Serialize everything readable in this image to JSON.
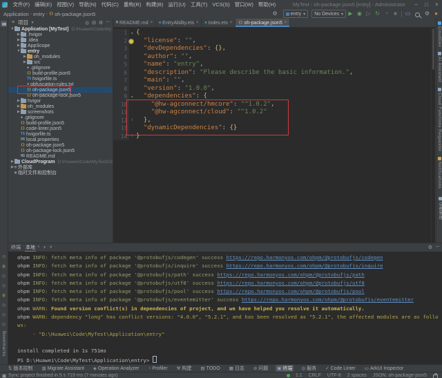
{
  "colors": {
    "accent_green": "#499c54",
    "annotation_red": "#cf3b3b",
    "link_blue": "#5f91c8",
    "warn_yellow": "#b3a24a",
    "selection_blue": "#234a6e",
    "notification_orange": "#cf8446"
  },
  "titlebar": {
    "title": "MyTest - oh-package.json5 [entry] - Administrator",
    "menus": [
      "文件(F)",
      "编辑(E)",
      "视图(V)",
      "导航(N)",
      "代码(C)",
      "重构(R)",
      "构建(B)",
      "运行(U)",
      "工具(T)",
      "VCS(S)",
      "窗口(W)",
      "帮助(H)"
    ],
    "window_buttons": [
      "minimize",
      "maximize",
      "close"
    ]
  },
  "toolbar": {
    "breadcrumbs": [
      "Application",
      "entry",
      "oh-package.json5"
    ],
    "module_selector": "entry",
    "device_selector": "No Devices",
    "icons": [
      "settings-sync-icon",
      "run-icon",
      "debug-icon",
      "attach-debugger-icon",
      "restart-app-icon",
      "profiler-icon",
      "stop-icon",
      "device-manager-icon",
      "search-everywhere-icon",
      "settings-icon",
      "notifications-icon"
    ]
  },
  "left_stripe": {
    "top_label": "项目",
    "bottom_label": "Bookmarks",
    "terminal_icon_count": 8
  },
  "project_panel": {
    "title": "项目",
    "header_icons": [
      "hamburger-icon",
      "locate-file-icon",
      "collapse-all-icon",
      "panel-settings-icon",
      "hide-panel-icon"
    ],
    "tree": [
      {
        "label": "Application [MyTest]",
        "path": "D:\\Huawei\\Code\\MyTest\\Application",
        "lvl": 0,
        "arrow": "open",
        "icon": "folder",
        "bold": true
      },
      {
        "label": ".hvigor",
        "lvl": 1,
        "arrow": "closed",
        "icon": "folder"
      },
      {
        "label": ".idea",
        "lvl": 1,
        "arrow": "closed",
        "icon": "folder"
      },
      {
        "label": "AppScope",
        "lvl": 1,
        "arrow": "closed",
        "icon": "folder"
      },
      {
        "label": "entry",
        "lvl": 1,
        "arrow": "open",
        "icon": "folder",
        "bold": true
      },
      {
        "label": "oh_modules",
        "lvl": 2,
        "arrow": "closed",
        "icon": "folder-orange"
      },
      {
        "label": "src",
        "lvl": 2,
        "arrow": "closed",
        "icon": "folder"
      },
      {
        "label": ".gitignore",
        "lvl": 2,
        "icon": "git"
      },
      {
        "label": "build-profile.json5",
        "lvl": 2,
        "icon": "json"
      },
      {
        "label": "hvigorfile.ts",
        "lvl": 2,
        "icon": "ts"
      },
      {
        "label": "obfuscation-rules.txt",
        "lvl": 2,
        "icon": "txt"
      },
      {
        "label": "oh-package.json5",
        "lvl": 2,
        "icon": "json",
        "selected": true,
        "annotated": true
      },
      {
        "label": "oh-package-lock.json5",
        "lvl": 2,
        "icon": "json"
      },
      {
        "label": "hvigor",
        "lvl": 1,
        "arrow": "closed",
        "icon": "folder"
      },
      {
        "label": "oh_modules",
        "lvl": 1,
        "arrow": "closed",
        "icon": "folder-orange"
      },
      {
        "label": "screenshots",
        "lvl": 1,
        "arrow": "closed",
        "icon": "folder"
      },
      {
        "label": ".gitignore",
        "lvl": 1,
        "icon": "git"
      },
      {
        "label": "build-profile.json5",
        "lvl": 1,
        "icon": "json"
      },
      {
        "label": "code-linter.json5",
        "lvl": 1,
        "icon": "json"
      },
      {
        "label": "hvigorfile.ts",
        "lvl": 1,
        "icon": "ts"
      },
      {
        "label": "local.properties",
        "lvl": 1,
        "icon": "props"
      },
      {
        "label": "oh-package.json5",
        "lvl": 1,
        "icon": "json"
      },
      {
        "label": "oh-package-lock.json5",
        "lvl": 1,
        "icon": "json"
      },
      {
        "label": "README.md",
        "lvl": 1,
        "icon": "md"
      },
      {
        "label": "CloudProgram",
        "path": "D:\\Huawei\\Code\\MyTest\\CloudProgram",
        "lvl": 0,
        "arrow": "closed",
        "icon": "folder",
        "bold": true
      },
      {
        "label": "外部库",
        "lvl": 0,
        "arrow": "closed",
        "icon": "lib"
      },
      {
        "label": "临时文件和控制台",
        "lvl": 0,
        "icon": "scratch"
      }
    ]
  },
  "editor": {
    "tabs": [
      {
        "label": "README.md",
        "icon": "md",
        "active": false
      },
      {
        "label": "EntryAbility.ets",
        "icon": "ets",
        "active": false
      },
      {
        "label": "Index.ets",
        "icon": "ets",
        "active": false
      },
      {
        "label": "oh-package.json5",
        "icon": "json",
        "active": true
      }
    ],
    "annotation": {
      "from_line": 9,
      "to_line": 12
    },
    "lines": [
      {
        "n": 1,
        "fold": "open",
        "seg": [
          [
            "br",
            "{"
          ]
        ]
      },
      {
        "n": 2,
        "bulb": true,
        "seg": [
          [
            "p",
            "  "
          ],
          [
            "k",
            "\"license\""
          ],
          [
            "p",
            ": "
          ],
          [
            "s",
            "\"\""
          ],
          [
            "p",
            ","
          ]
        ]
      },
      {
        "n": 3,
        "seg": [
          [
            "p",
            "  "
          ],
          [
            "k",
            "\"devDependencies\""
          ],
          [
            "p",
            ": "
          ],
          [
            "br",
            "{}"
          ],
          [
            "p",
            ","
          ]
        ]
      },
      {
        "n": 4,
        "seg": [
          [
            "p",
            "  "
          ],
          [
            "k",
            "\"author\""
          ],
          [
            "p",
            ": "
          ],
          [
            "s",
            "\"\""
          ],
          [
            "p",
            ","
          ]
        ]
      },
      {
        "n": 5,
        "seg": [
          [
            "p",
            "  "
          ],
          [
            "k",
            "\"name\""
          ],
          [
            "p",
            ": "
          ],
          [
            "s",
            "\"entry\""
          ],
          [
            "p",
            ","
          ]
        ]
      },
      {
        "n": 6,
        "seg": [
          [
            "p",
            "  "
          ],
          [
            "k",
            "\"description\""
          ],
          [
            "p",
            ": "
          ],
          [
            "s",
            "\"Please describe the basic information.\""
          ],
          [
            "p",
            ","
          ]
        ]
      },
      {
        "n": 7,
        "seg": [
          [
            "p",
            "  "
          ],
          [
            "k",
            "\"main\""
          ],
          [
            "p",
            ": "
          ],
          [
            "s",
            "\"\""
          ],
          [
            "p",
            ","
          ]
        ]
      },
      {
        "n": 8,
        "seg": [
          [
            "p",
            "  "
          ],
          [
            "k",
            "\"version\""
          ],
          [
            "p",
            ": "
          ],
          [
            "s",
            "\"1.0.0\""
          ],
          [
            "p",
            ","
          ]
        ]
      },
      {
        "n": 9,
        "fold": "open",
        "seg": [
          [
            "p",
            "  "
          ],
          [
            "k",
            "\"dependencies\""
          ],
          [
            "p",
            ": "
          ],
          [
            "br",
            "{"
          ]
        ]
      },
      {
        "n": 10,
        "seg": [
          [
            "p",
            "    "
          ],
          [
            "k",
            "\"@hw-agconnect/hmcore\""
          ],
          [
            "p",
            ": "
          ],
          [
            "s",
            "\"^1.0.2\""
          ],
          [
            "p",
            ","
          ]
        ]
      },
      {
        "n": 11,
        "seg": [
          [
            "p",
            "    "
          ],
          [
            "k",
            "\"@hw-agconnect/cloud\""
          ],
          [
            "p",
            ": "
          ],
          [
            "s",
            "\"^1.0.2\""
          ]
        ]
      },
      {
        "n": 12,
        "fold": "end",
        "seg": [
          [
            "p",
            "  "
          ],
          [
            "br",
            "},"
          ]
        ]
      },
      {
        "n": 13,
        "seg": [
          [
            "p",
            "  "
          ],
          [
            "k",
            "\"dynamicDependencies\""
          ],
          [
            "p",
            ": "
          ],
          [
            "br",
            "{}"
          ]
        ]
      },
      {
        "n": 14,
        "fold": "end",
        "seg": [
          [
            "br",
            "}"
          ]
        ]
      }
    ]
  },
  "right_stripe": {
    "items": [
      "CloudDev",
      "AI Assistant",
      "Cloud Functions Requestor",
      "Notifications",
      "设备管理"
    ]
  },
  "terminal": {
    "title": "终端",
    "tab": "本地",
    "header_icons": [
      "new-session-icon",
      "sessions-dropdown-icon",
      "terminal-settings-icon",
      "hide-panel-icon"
    ],
    "lines": [
      {
        "seg": [
          [
            "tg",
            "ohpm "
          ],
          [
            "ti",
            "INFO: fetch meta info of package '@protobufjs/codegen' success "
          ],
          [
            "tl",
            "https://repo.harmonyos.com/ohpm/@protobufjs/codegen"
          ]
        ]
      },
      {
        "seg": [
          [
            "tg",
            "ohpm "
          ],
          [
            "ti",
            "INFO: fetch meta info of package '@protobufjs/inquire' success "
          ],
          [
            "tl",
            "https://repo.harmonyos.com/ohpm/@protobufjs/inquire"
          ]
        ]
      },
      {
        "seg": [
          [
            "tg",
            "ohpm "
          ],
          [
            "ti",
            "INFO: fetch meta info of package '@protobufjs/path' success "
          ],
          [
            "tl",
            "https://repo.harmonyos.com/ohpm/@protobufjs/path"
          ]
        ]
      },
      {
        "seg": [
          [
            "tg",
            "ohpm "
          ],
          [
            "ti",
            "INFO: fetch meta info of package '@protobufjs/utf8' success "
          ],
          [
            "tl",
            "https://repo.harmonyos.com/ohpm/@protobufjs/utf8"
          ]
        ]
      },
      {
        "seg": [
          [
            "tg",
            "ohpm "
          ],
          [
            "ti",
            "INFO: fetch meta info of package '@protobufjs/pool' success "
          ],
          [
            "tl",
            "https://repo.harmonyos.com/ohpm/@protobufjs/pool"
          ]
        ]
      },
      {
        "seg": [
          [
            "tg",
            "ohpm "
          ],
          [
            "ti",
            "INFO: fetch meta info of package '@protobufjs/eventemitter' success "
          ],
          [
            "tl",
            "https://repo.harmonyos.com/ohpm/@protobufjs/eventemitter"
          ]
        ]
      },
      {
        "seg": [
          [
            "tg",
            "ohpm "
          ],
          [
            "tw",
            "WARN: "
          ],
          [
            "twb",
            "Found version conflict(s) in dependencies of project, and we have helped you resolve it automatically."
          ]
        ]
      },
      {
        "seg": [
          [
            "tg",
            "ohpm "
          ],
          [
            "tw",
            "WARN: dependency \"long\" has conflict versions: \"4.0.0\", \"5.2.1\", and has been resolved as \"5.2.1\", the affected modules are as follows:"
          ]
        ]
      },
      {
        "seg": [
          [
            "tw",
            "     - \"D:\\Huawei\\Code\\MyTest\\Application\\entry\""
          ]
        ]
      },
      {
        "seg": []
      },
      {
        "seg": [
          [
            "tg",
            "install completed in 1s 751ms"
          ]
        ]
      },
      {
        "seg": [
          [
            "tg",
            "PS D:\\Huawei\\Code\\MyTest\\Application\\entry> "
          ],
          [
            "cur",
            ""
          ]
        ]
      }
    ]
  },
  "bottom_bar": {
    "items": [
      {
        "label": "版本控制",
        "icon": "vcs"
      },
      {
        "label": "Migrate Assistant",
        "icon": "migrate"
      },
      {
        "label": "Operation Analyzer",
        "icon": "analyzer"
      },
      {
        "label": "Profiler",
        "icon": "profiler"
      },
      {
        "label": "构建",
        "icon": "build"
      },
      {
        "label": "TODO",
        "icon": "todo"
      },
      {
        "label": "日志",
        "icon": "log"
      },
      {
        "label": "问题",
        "icon": "problems"
      },
      {
        "label": "终端",
        "icon": "terminal",
        "active": true
      },
      {
        "label": "服务",
        "icon": "services"
      },
      {
        "label": "Code Linter",
        "icon": "linter"
      },
      {
        "label": "ArkUI Inspector",
        "icon": "arkui"
      }
    ]
  },
  "statusbar": {
    "message": "Sync project finished in 5 s 719 ms (7 minutes ago)",
    "items": [
      "1:1",
      "CRLF",
      "UTF-8",
      "2 spaces",
      "JSON: oh-package-json5"
    ]
  }
}
